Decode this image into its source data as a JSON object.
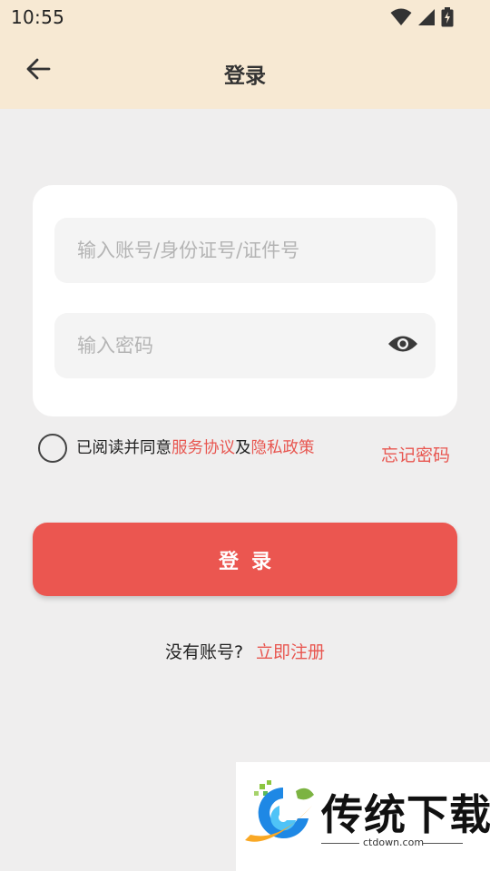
{
  "status_bar": {
    "time": "10:55",
    "icons": [
      "wifi-icon",
      "cellular-signal-icon",
      "battery-charging-icon"
    ]
  },
  "header": {
    "back_icon": "arrow-left-icon",
    "title": "登录"
  },
  "form": {
    "account_placeholder": "输入账号/身份证号/证件号",
    "account_value": "",
    "password_placeholder": "输入密码",
    "password_value": "",
    "password_toggle_icon": "eye-icon"
  },
  "agreement": {
    "checked": false,
    "prefix": "已阅读并同意",
    "terms_link": "服务协议",
    "conjunction": "及",
    "privacy_link": "隐私政策"
  },
  "forgot_password": "忘记密码",
  "login_button": "登录",
  "register": {
    "prompt": "没有账号?",
    "link": "立即注册"
  },
  "watermark": {
    "title": "传统下载",
    "domain": "ctdown.com"
  },
  "colors": {
    "accent": "#eb5650",
    "link": "#e85650",
    "header_bg": "#f7e9d3",
    "page_bg": "#efeeee"
  }
}
